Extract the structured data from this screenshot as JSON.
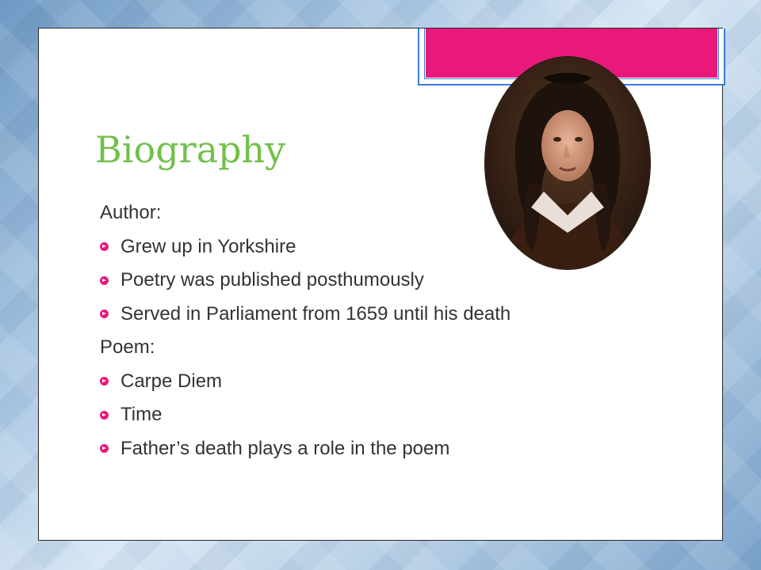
{
  "slide": {
    "title": "Biography",
    "section_author": "Author:",
    "author_points": [
      "Grew up in Yorkshire",
      "Poetry was published posthumously",
      "Served in Parliament from 1659 until his death"
    ],
    "section_poem": "Poem:",
    "poem_points": [
      "Carpe Diem",
      "Time",
      "Father’s death plays a role in the poem"
    ]
  },
  "colors": {
    "title": "#72c04a",
    "accent": "#e8197a",
    "frame": "#3a7bd5",
    "body_text": "#333333"
  },
  "icons": {
    "bullet": "circled-arrow-bullet-icon"
  }
}
